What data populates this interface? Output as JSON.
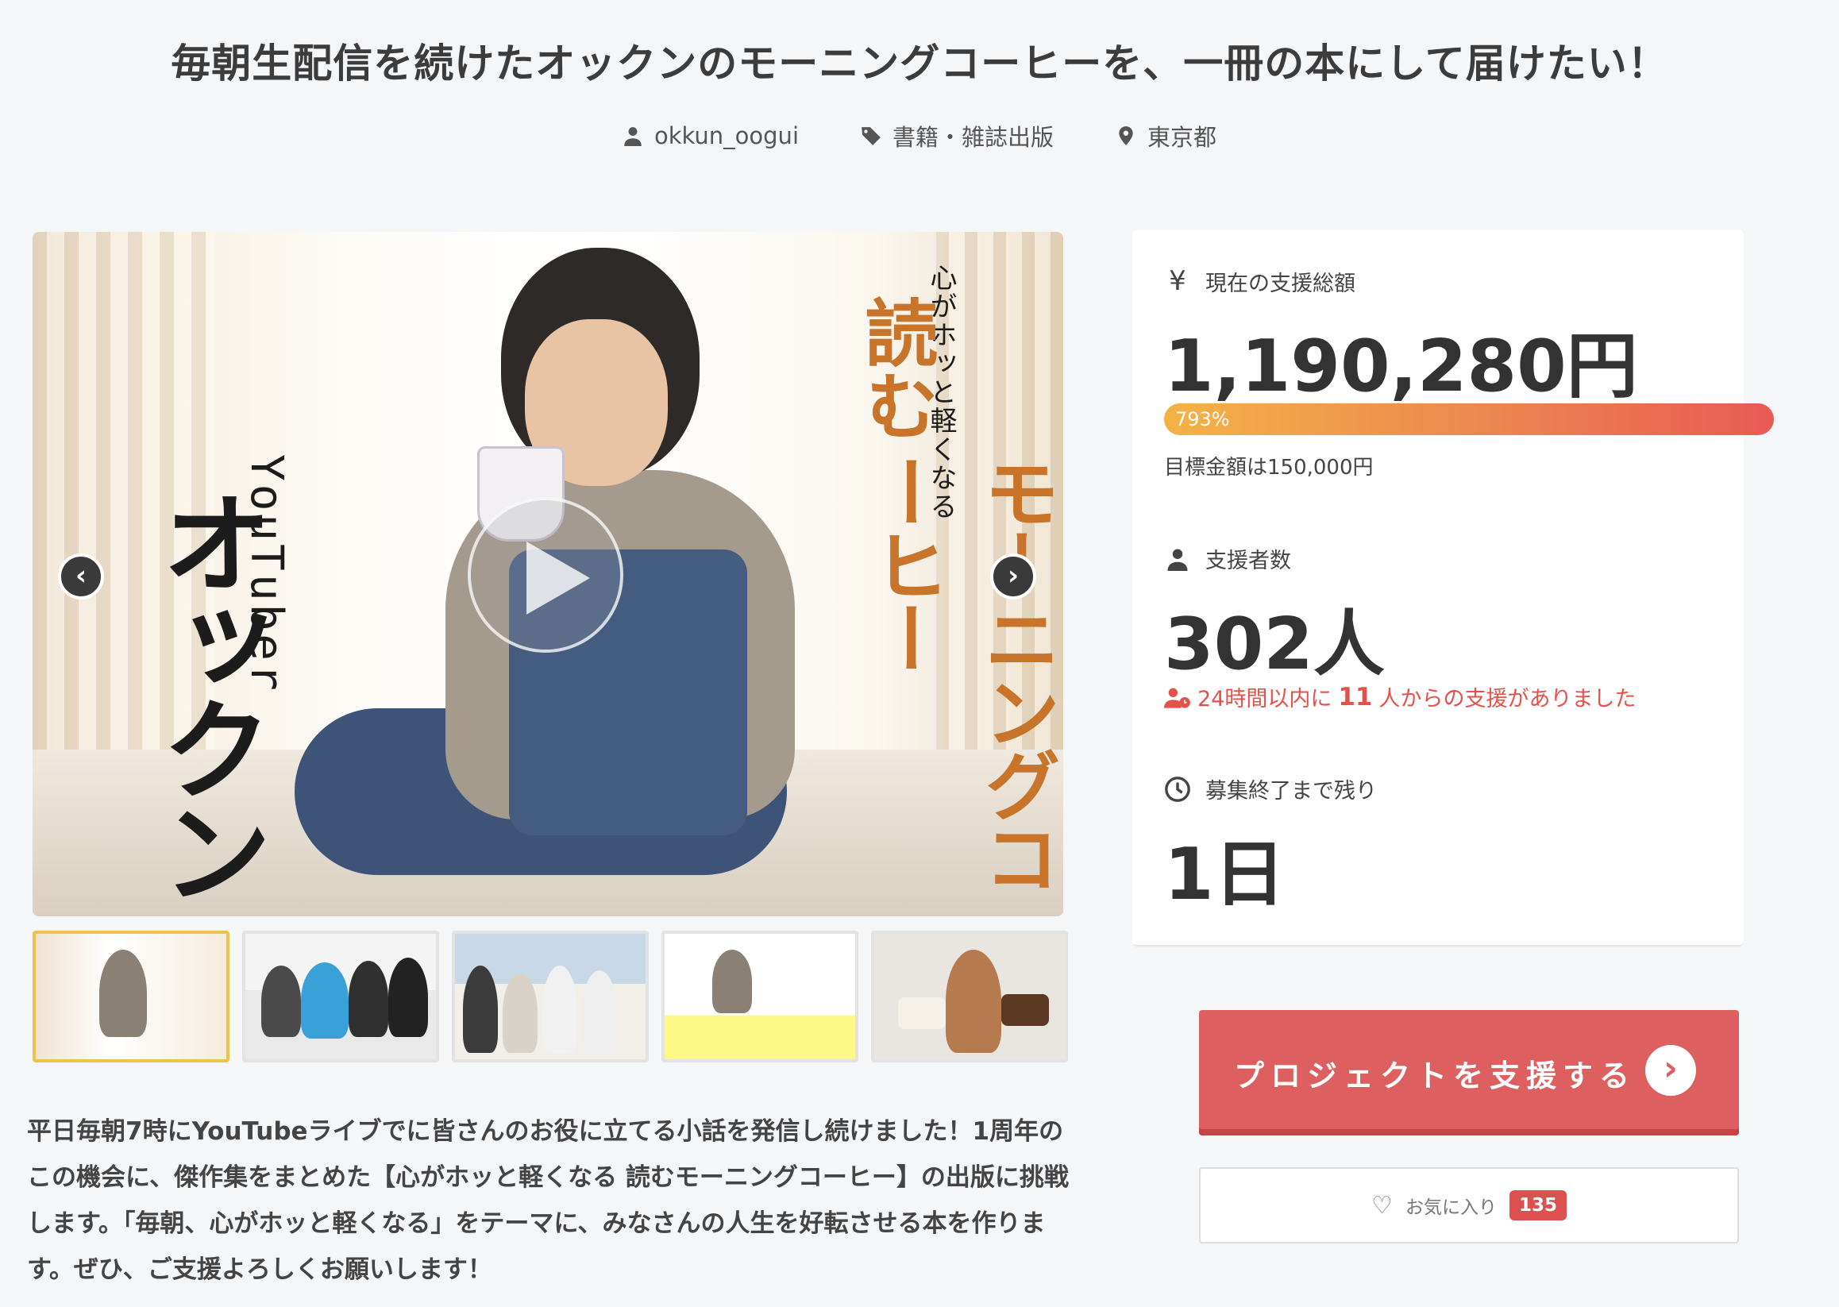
{
  "page": {
    "title": "毎朝生配信を続けたオックンのモーニングコーヒーを、一冊の本にして届けたい！"
  },
  "meta": {
    "owner": "okkun_oogui",
    "category": "書籍・雑誌出版",
    "location": "東京都"
  },
  "hero": {
    "cover_small_text": "心がホッと軽くなる",
    "cover_title_1": "読む",
    "cover_title_2": "モーニングコーヒー",
    "cover_sub": "YouTuber",
    "cover_name": "オックン",
    "prev_arrow": "‹",
    "next_arrow": "›"
  },
  "thumbnails": {
    "count": 5,
    "active_index": 0
  },
  "description": "平日毎朝7時にYouTubeライブでに皆さんのお役に立てる小話を発信し続けました！1周年のこの機会に、傑作集をまとめた【心がホッと軽くなる 読むモーニングコーヒー】の出版に挑戦します。「毎朝、心がホッと軽くなる」をテーマに、みなさんの人生を好転させる本を作ります。ぜひ、ご支援よろしくお願いします！",
  "stats": {
    "total_label": "現在の支援総額",
    "total_value": "1,190,280円",
    "progress_text": "793%",
    "progress_percent": 793,
    "goal_text": "目標金額は150,000円",
    "backers_label": "支援者数",
    "backers_value": "302人",
    "recent_prefix": "24時間以内に",
    "recent_count": "11",
    "recent_suffix": "人からの支援がありました",
    "remaining_label": "募集終了まで残り",
    "remaining_value": "1日"
  },
  "actions": {
    "support_label": "プロジェクトを支援する",
    "favorite_label": "お気に入り",
    "favorite_count": "135"
  },
  "icons": {
    "yen": "¥",
    "go": "›",
    "heart": "♡"
  },
  "colors": {
    "accent": "#dd5f5f",
    "recent_text": "#e3524b",
    "thumb_active": "#f1c24b"
  }
}
